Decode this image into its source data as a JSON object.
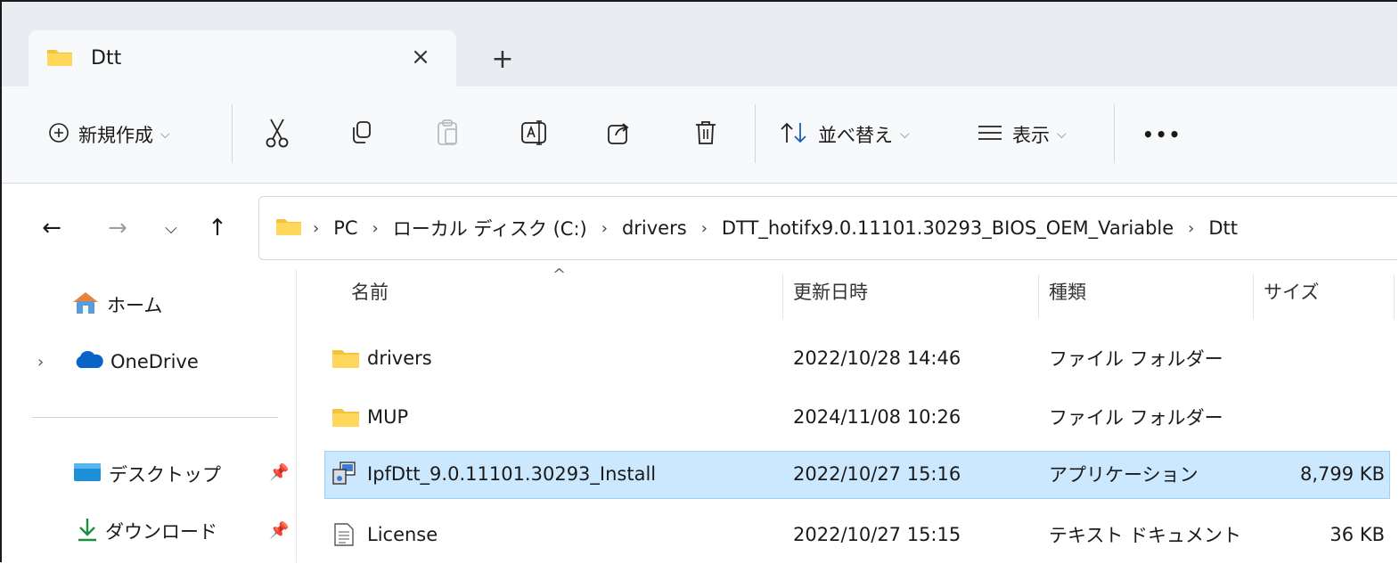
{
  "tab": {
    "title": "Dtt",
    "close_icon": "×",
    "new_tab_icon": "+"
  },
  "toolbar": {
    "new_label": "新規作成",
    "sort_label": "並べ替え",
    "view_label": "表示",
    "more_label": "•••"
  },
  "address": {
    "crumbs": [
      "PC",
      "ローカル ディスク (C:)",
      "drivers",
      "DTT_hotifx9.0.11101.30293_BIOS_OEM_Variable",
      "Dtt"
    ]
  },
  "sidebar": {
    "items": [
      {
        "label": "ホーム"
      },
      {
        "label": "OneDrive"
      },
      {
        "label": "デスクトップ"
      },
      {
        "label": "ダウンロード"
      }
    ]
  },
  "columns": {
    "name": "名前",
    "modified": "更新日時",
    "type": "種類",
    "size": "サイズ"
  },
  "files": [
    {
      "name": "drivers",
      "modified": "2022/10/28 14:46",
      "type": "ファイル フォルダー",
      "size": ""
    },
    {
      "name": "MUP",
      "modified": "2024/11/08 10:26",
      "type": "ファイル フォルダー",
      "size": ""
    },
    {
      "name": "IpfDtt_9.0.11101.30293_Install",
      "modified": "2022/10/27 15:16",
      "type": "アプリケーション",
      "size": "8,799 KB"
    },
    {
      "name": "License",
      "modified": "2022/10/27 15:15",
      "type": "テキスト ドキュメント",
      "size": "36 KB"
    }
  ],
  "colors": {
    "selection": "#cce8ff",
    "folder": "#f5c33b",
    "onedrive": "#0a64c8",
    "home_roof": "#e8813a",
    "download": "#1c8f3c"
  }
}
